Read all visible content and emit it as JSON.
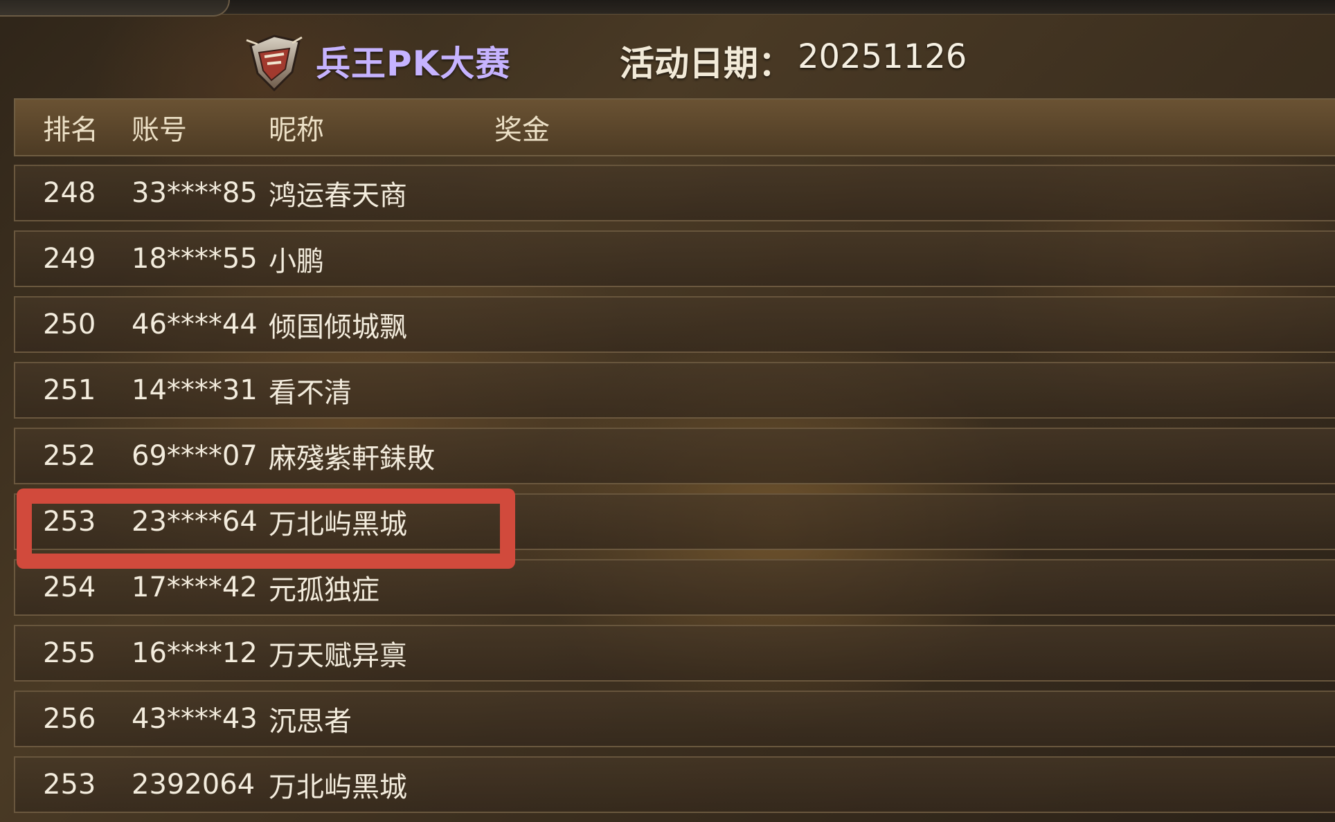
{
  "header": {
    "title": "兵王PK大赛",
    "date_label": "活动日期：",
    "date_value": "20251126"
  },
  "table": {
    "columns": [
      "排名",
      "账号",
      "昵称",
      "奖金"
    ],
    "rows": [
      {
        "rank": "248",
        "account": "33****85",
        "nickname": "鸿运春天商"
      },
      {
        "rank": "249",
        "account": "18****55",
        "nickname": "小鹏"
      },
      {
        "rank": "250",
        "account": "46****44",
        "nickname": "倾国倾城飘"
      },
      {
        "rank": "251",
        "account": "14****31",
        "nickname": "看不清"
      },
      {
        "rank": "252",
        "account": "69****07",
        "nickname": "麻殘紫軒銇敗"
      },
      {
        "rank": "253",
        "account": "23****64",
        "nickname": "万北屿黑城"
      },
      {
        "rank": "254",
        "account": "17****42",
        "nickname": "元孤独症"
      },
      {
        "rank": "255",
        "account": "16****12",
        "nickname": "万天赋异禀"
      },
      {
        "rank": "256",
        "account": "43****43",
        "nickname": "沉思者"
      },
      {
        "rank": "253",
        "account": "2392064",
        "nickname": "万北屿黑城"
      }
    ]
  },
  "colors": {
    "highlight": "#d14a3c",
    "title": "#c6b3ff"
  }
}
